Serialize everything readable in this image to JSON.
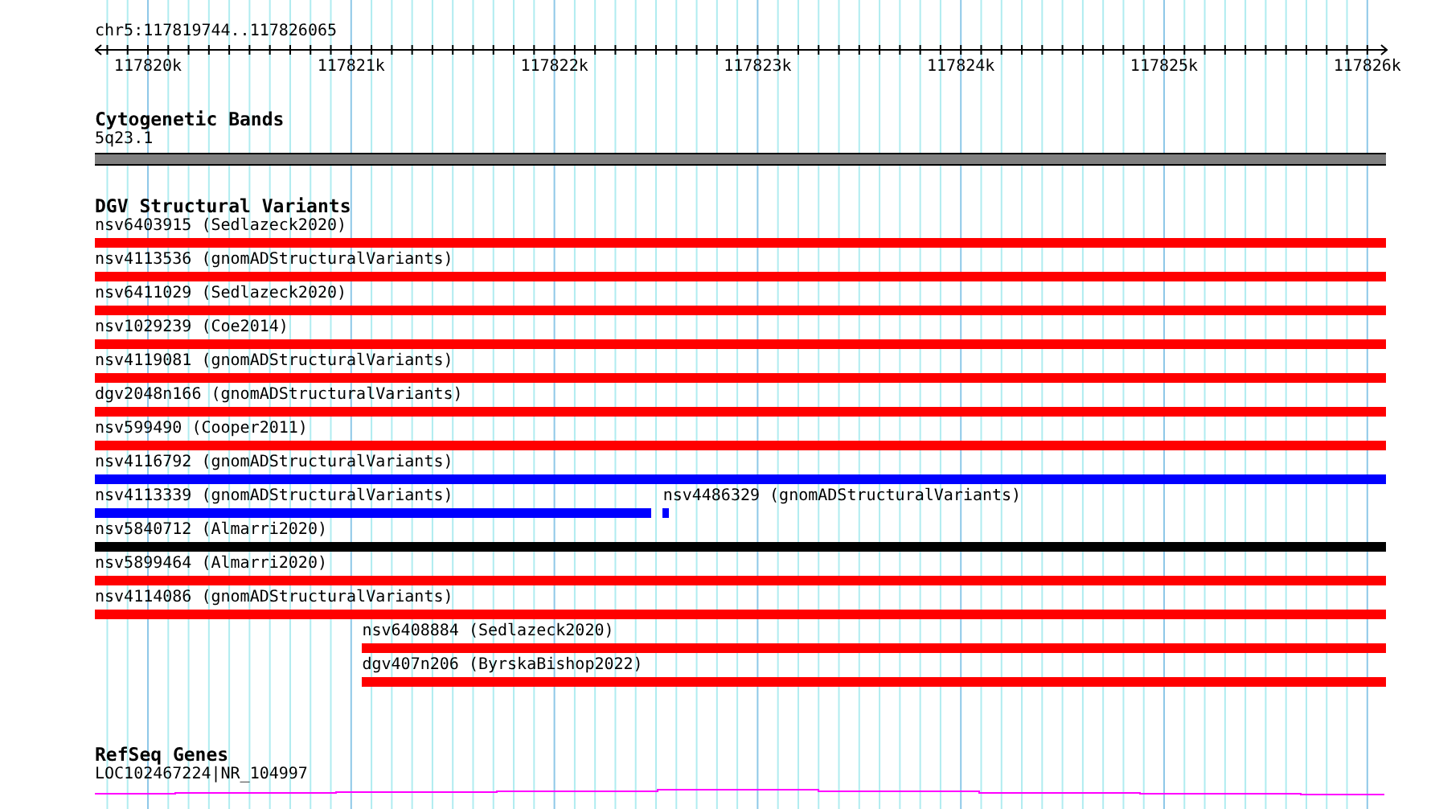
{
  "ruler": {
    "location": "chr5:117819744..117826065",
    "ticks": [
      "117820k",
      "117821k",
      "117822k",
      "117823k",
      "117824k",
      "117825k",
      "117826k"
    ]
  },
  "cytogenetic_bands": {
    "title": "Cytogenetic Bands",
    "band": "5q23.1"
  },
  "dgv_structural_variants": {
    "title": "DGV Structural Variants",
    "rows": [
      {
        "features": [
          {
            "label": "nsv6403915 (Sedlazeck2020)",
            "color": "#ff0000",
            "kind": "whole"
          }
        ]
      },
      {
        "features": [
          {
            "label": "nsv4113536 (gnomADStructuralVariants)",
            "color": "#ff0000",
            "kind": "whole"
          }
        ]
      },
      {
        "features": [
          {
            "label": "nsv6411029 (Sedlazeck2020)",
            "color": "#ff0000",
            "kind": "whole"
          }
        ]
      },
      {
        "features": [
          {
            "label": "nsv1029239 (Coe2014)",
            "color": "#ff0000",
            "kind": "whole"
          }
        ]
      },
      {
        "features": [
          {
            "label": "nsv4119081 (gnomADStructuralVariants)",
            "color": "#ff0000",
            "kind": "whole"
          }
        ]
      },
      {
        "features": [
          {
            "label": "dgv2048n166 (gnomADStructuralVariants)",
            "color": "#ff0000",
            "kind": "whole"
          }
        ]
      },
      {
        "features": [
          {
            "label": "nsv599490 (Cooper2011)",
            "color": "#ff0000",
            "kind": "whole"
          }
        ]
      },
      {
        "features": [
          {
            "label": "nsv4116792 (gnomADStructuralVariants)",
            "color": "#0000ff",
            "kind": "whole"
          }
        ]
      },
      {
        "features": [
          {
            "label": "nsv4113339 (gnomADStructuralVariants)",
            "color": "#0000ff",
            "kind": "left"
          },
          {
            "label": "nsv4486329 (gnomADStructuralVariants)",
            "color": "#0000ff",
            "kind": "tick"
          }
        ]
      },
      {
        "features": [
          {
            "label": "nsv5840712 (Almarri2020)",
            "color": "#000000",
            "kind": "whole"
          }
        ]
      },
      {
        "features": [
          {
            "label": "nsv5899464 (Almarri2020)",
            "color": "#ff0000",
            "kind": "whole"
          }
        ]
      },
      {
        "features": [
          {
            "label": "nsv4114086 (gnomADStructuralVariants)",
            "color": "#ff0000",
            "kind": "whole"
          }
        ]
      },
      {
        "features": [
          {
            "label": "nsv6408884 (Sedlazeck2020)",
            "color": "#ff0000",
            "kind": "right"
          }
        ]
      },
      {
        "features": [
          {
            "label": "dgv407n206 (ByrskaBishop2022)",
            "color": "#ff0000",
            "kind": "right"
          }
        ]
      }
    ]
  },
  "refseq_genes": {
    "title": "RefSeq Genes",
    "genes": [
      {
        "label": "LOC102467224|NR_104997"
      }
    ]
  }
}
